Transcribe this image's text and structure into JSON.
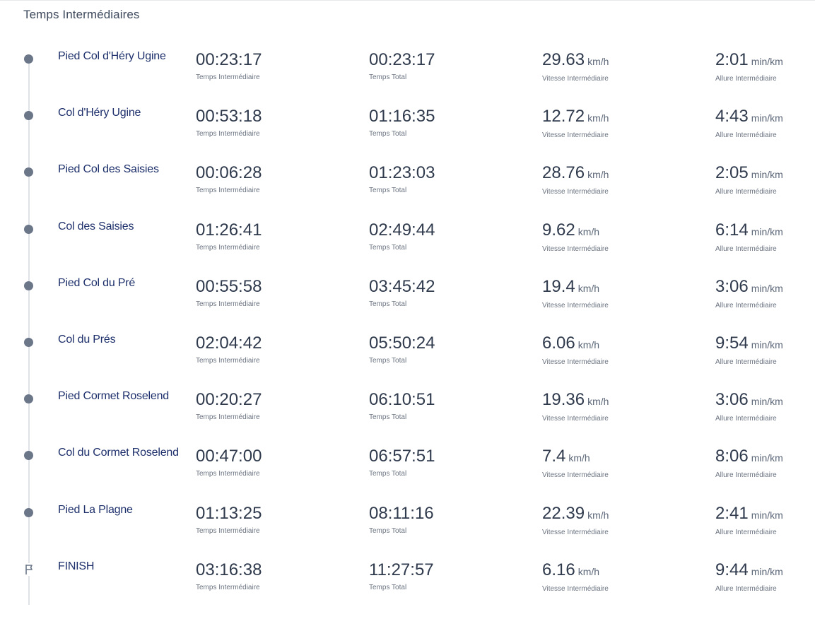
{
  "section_title": "Temps Intermédiaires",
  "labels": {
    "split": "Temps Intermédiaire",
    "total": "Temps Total",
    "speed": "Vitesse Intermédiaire",
    "pace": "Allure Intermédiaire",
    "speed_unit": "km/h",
    "pace_unit": "min/km"
  },
  "splits": [
    {
      "name": "Pied Col d'Héry Ugine",
      "split": "00:23:17",
      "total": "00:23:17",
      "speed": "29.63",
      "pace": "2:01"
    },
    {
      "name": "Col d'Héry Ugine",
      "split": "00:53:18",
      "total": "01:16:35",
      "speed": "12.72",
      "pace": "4:43"
    },
    {
      "name": "Pied Col des Saisies",
      "split": "00:06:28",
      "total": "01:23:03",
      "speed": "28.76",
      "pace": "2:05"
    },
    {
      "name": "Col des Saisies",
      "split": "01:26:41",
      "total": "02:49:44",
      "speed": "9.62",
      "pace": "6:14"
    },
    {
      "name": "Pied Col du Pré",
      "split": "00:55:58",
      "total": "03:45:42",
      "speed": "19.4",
      "pace": "3:06"
    },
    {
      "name": "Col du Prés",
      "split": "02:04:42",
      "total": "05:50:24",
      "speed": "6.06",
      "pace": "9:54"
    },
    {
      "name": "Pied Cormet Roselend",
      "split": "00:20:27",
      "total": "06:10:51",
      "speed": "19.36",
      "pace": "3:06"
    },
    {
      "name": "Col du Cormet Roselend",
      "split": "00:47:00",
      "total": "06:57:51",
      "speed": "7.4",
      "pace": "8:06"
    },
    {
      "name": "Pied La Plagne",
      "split": "01:13:25",
      "total": "08:11:16",
      "speed": "22.39",
      "pace": "2:41"
    },
    {
      "name": "FINISH",
      "split": "03:16:38",
      "total": "11:27:57",
      "speed": "6.16",
      "pace": "9:44"
    }
  ]
}
